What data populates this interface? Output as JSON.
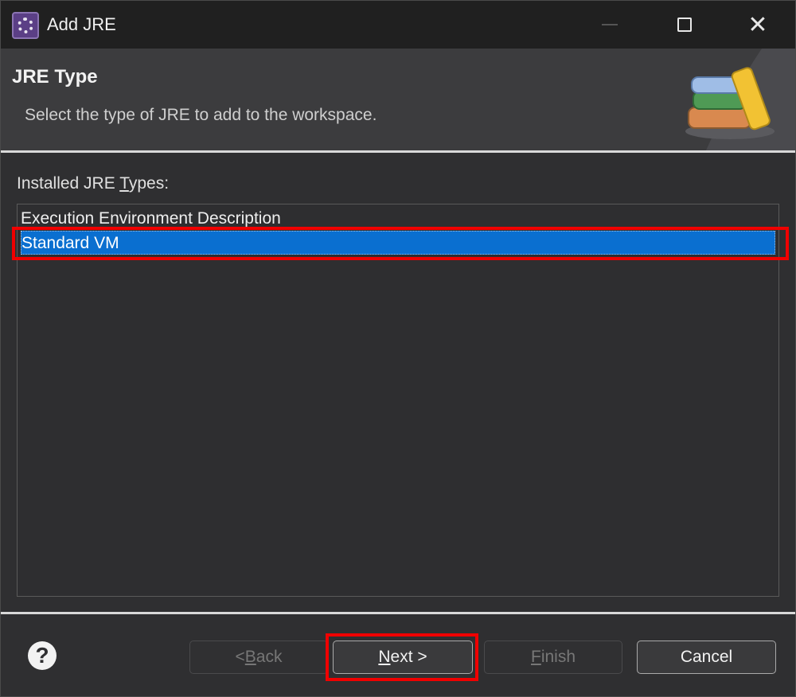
{
  "window": {
    "title": "Add JRE",
    "controls": {
      "minimize": "—",
      "maximize": "□",
      "close": "✕"
    }
  },
  "header": {
    "title": "JRE Type",
    "description": "Select the type of JRE to add to the workspace.",
    "icon": "books-icon"
  },
  "list": {
    "label_prefix": "Installed JRE ",
    "label_mnemonic": "T",
    "label_suffix": "ypes:",
    "items": [
      {
        "label": "Execution Environment Description",
        "selected": false
      },
      {
        "label": "Standard VM",
        "selected": true
      }
    ]
  },
  "footer": {
    "help_symbol": "?",
    "back": {
      "prefix": "< ",
      "mnemonic": "B",
      "suffix": "ack",
      "enabled": false
    },
    "next": {
      "mnemonic": "N",
      "suffix": "ext >",
      "enabled": true
    },
    "finish": {
      "mnemonic": "F",
      "suffix": "inish",
      "enabled": false
    },
    "cancel": {
      "label": "Cancel",
      "enabled": true
    }
  },
  "colors": {
    "selection": "#0a6fd0",
    "highlight_box": "#f00000",
    "background": "#2f2f31"
  }
}
